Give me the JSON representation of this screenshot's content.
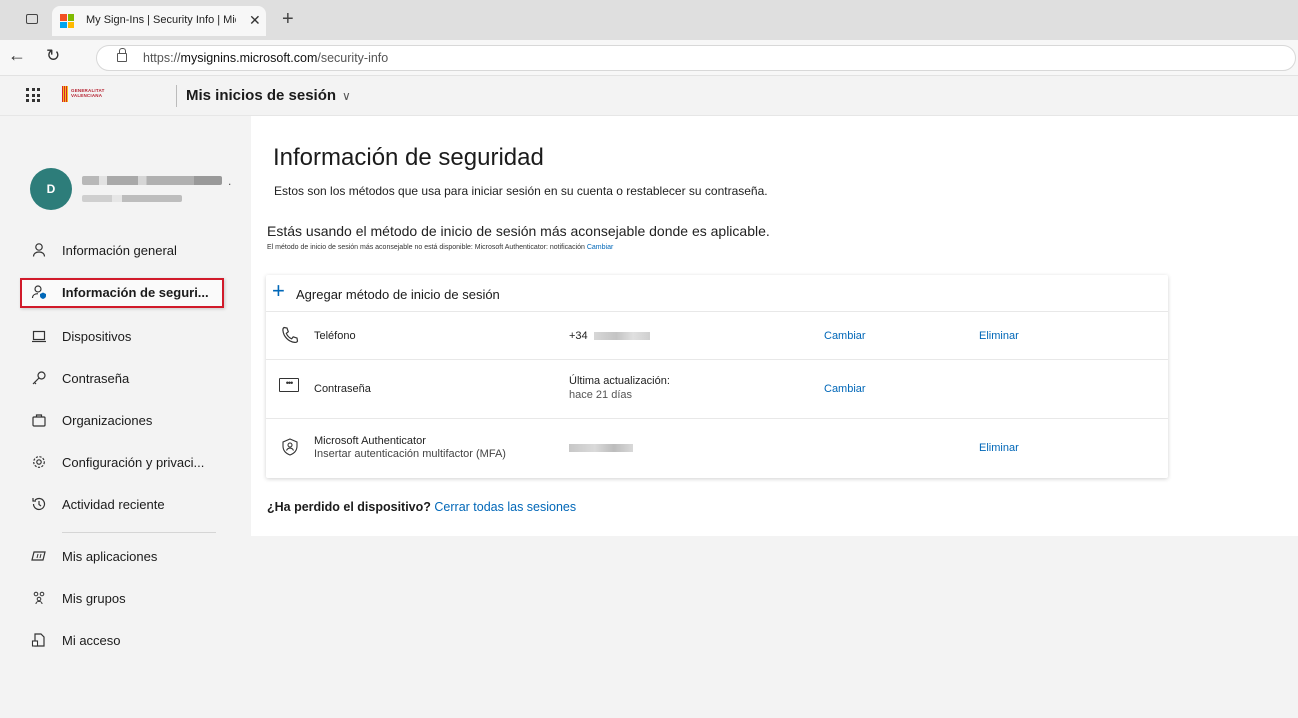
{
  "browser": {
    "tab_title": "My Sign-Ins | Security Info | Microsoft",
    "tab_close": "✕",
    "new_tab": "+",
    "url_prefix": "https://",
    "url_domain": "mysignins.microsoft.com",
    "url_path": "/security-info",
    "brand_colors": [
      "#f25022",
      "#7fba00",
      "#00a4ef",
      "#ffb900"
    ]
  },
  "header": {
    "org_logo_text_1": "GENERALITAT",
    "org_logo_text_2": "VALENCIANA",
    "app_title": "Mis inicios de sesión",
    "app_chevron": "∨"
  },
  "user": {
    "initial": "D",
    "name_suffix": "."
  },
  "sidebar": {
    "items": [
      {
        "label": "Información general",
        "icon": "person-icon"
      },
      {
        "label": "Información de seguri...",
        "icon": "security-info-icon"
      },
      {
        "label": "Dispositivos",
        "icon": "laptop-icon"
      },
      {
        "label": "Contraseña",
        "icon": "key-icon"
      },
      {
        "label": "Organizaciones",
        "icon": "briefcase-icon"
      },
      {
        "label": "Configuración y privaci...",
        "icon": "gear-icon"
      },
      {
        "label": "Actividad reciente",
        "icon": "history-icon"
      },
      {
        "label": "Mis aplicaciones",
        "icon": "apps-icon"
      },
      {
        "label": "Mis grupos",
        "icon": "groups-icon"
      },
      {
        "label": "Mi acceso",
        "icon": "access-icon"
      }
    ],
    "active_index": 1,
    "active_border_color": "#d11a2a"
  },
  "main": {
    "title": "Información de seguridad",
    "description": "Estos son los métodos que usa para iniciar sesión en su cuenta o restablecer su contraseña.",
    "recommendation_title": "Estás usando el método de inicio de sesión más aconsejable donde es aplicable.",
    "recommendation_sub": "El método de inicio de sesión más aconsejable no está disponible: Microsoft Authenticator: notificación",
    "recommendation_link": "Cambiar",
    "add_method": "Agregar método de inicio de sesión",
    "methods": [
      {
        "name": "Teléfono",
        "detail": "+34",
        "change": "Cambiar",
        "remove": "Eliminar",
        "icon": "phone-icon"
      },
      {
        "name": "Contraseña",
        "detail": "Última actualización:",
        "detail2": "hace 21 días",
        "change": "Cambiar",
        "icon": "password-icon"
      },
      {
        "name": "Microsoft Authenticator",
        "name2": "Insertar autenticación multifactor (MFA)",
        "remove": "Eliminar",
        "icon": "authenticator-icon"
      }
    ],
    "lost_device_q": "¿Ha perdido el dispositivo?",
    "lost_device_link": "Cerrar todas las sesiones",
    "link_color": "#0067b8"
  }
}
